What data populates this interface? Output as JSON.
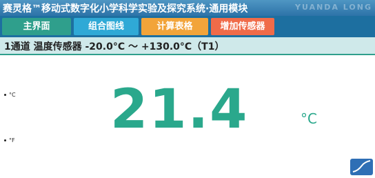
{
  "app": {
    "title": "赛灵格™移动式数字化小学科学实验及探究系统·通用模块",
    "watermark": "YUANDA LONG"
  },
  "tabs": [
    {
      "label": "主界面"
    },
    {
      "label": "组合图线"
    },
    {
      "label": "计算表格"
    },
    {
      "label": "增加传感器"
    }
  ],
  "channel": {
    "label": "1通道 温度传感器 -20.0°C ～ +130.0°C（T1）"
  },
  "units": {
    "celsius": "°C",
    "fahrenheit": "°F"
  },
  "reading": {
    "value": "21.4",
    "unit": "°C"
  },
  "colors": {
    "accent": "#2aa88c",
    "titlebar": "#2d73a8",
    "tab_main": "#2f9f8c",
    "tab_combo": "#2fa9d6",
    "tab_calc": "#f2a43a",
    "tab_add": "#f06b49"
  },
  "icons": {
    "chart_button": "line-chart-icon"
  }
}
